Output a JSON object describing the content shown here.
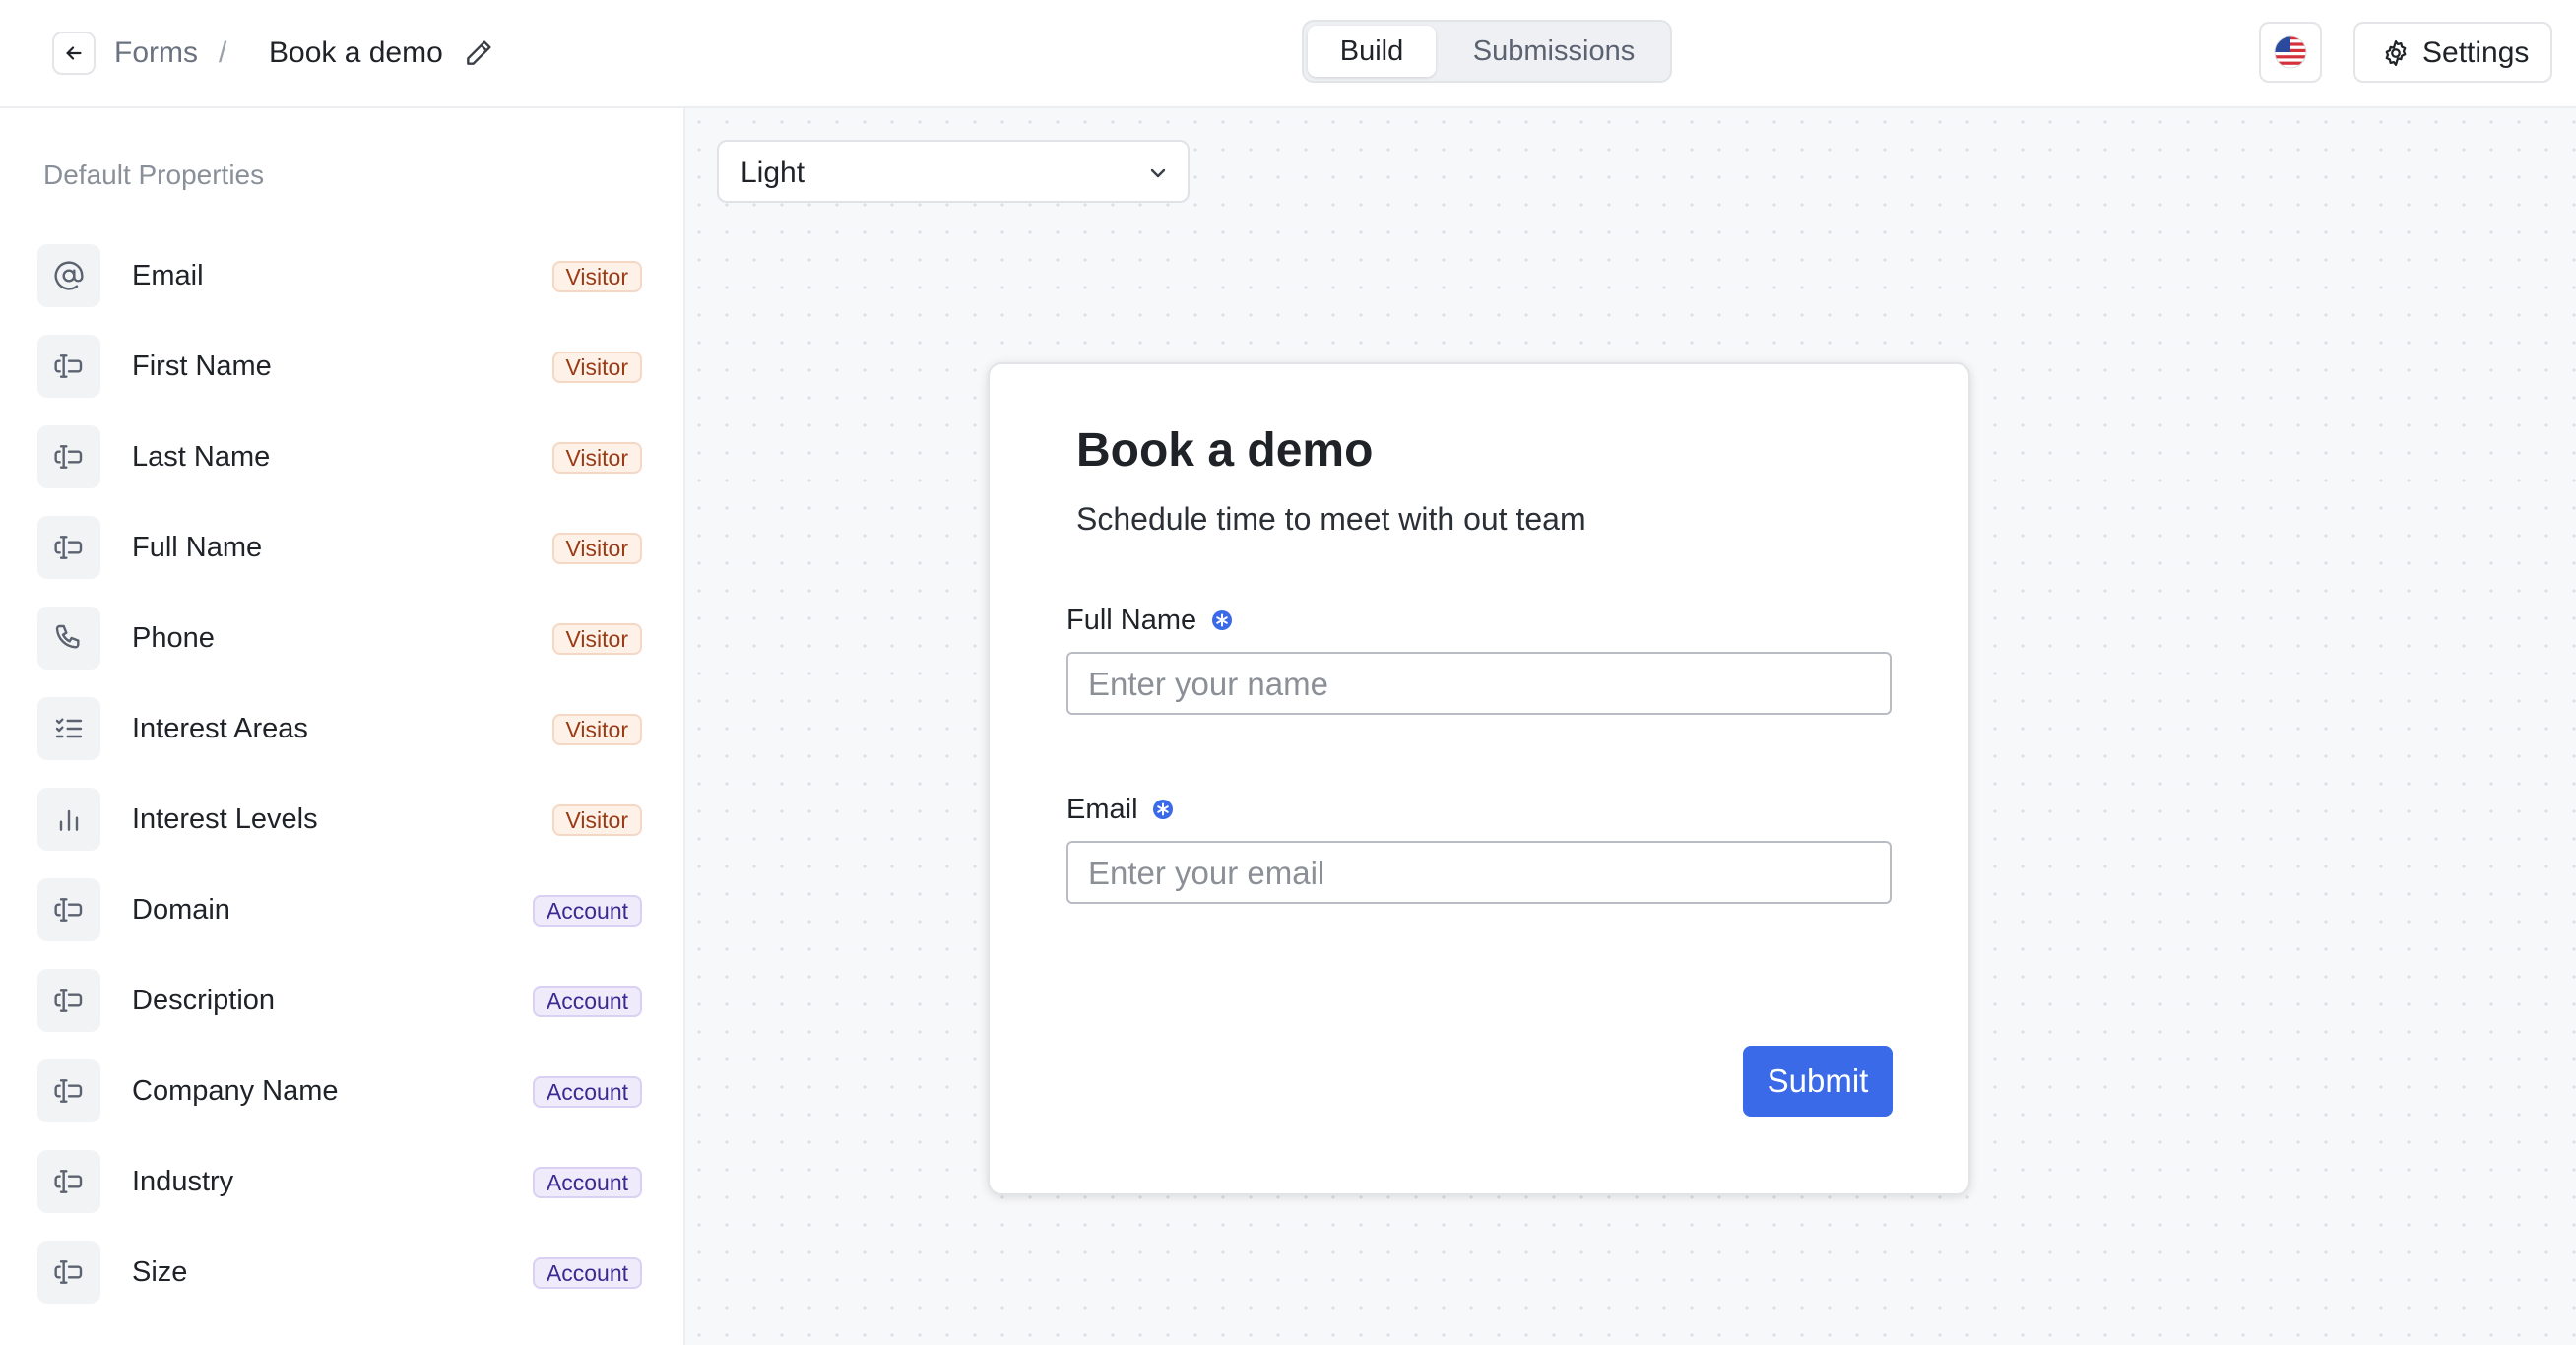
{
  "header": {
    "breadcrumb_root": "Forms",
    "breadcrumb_sep": "/",
    "breadcrumb_current": "Book a demo",
    "tabs": [
      {
        "label": "Build",
        "active": true
      },
      {
        "label": "Submissions",
        "active": false
      }
    ],
    "language_icon": "us-flag-icon",
    "settings_label": "Settings"
  },
  "sidebar": {
    "title": "Default Properties",
    "items": [
      {
        "label": "Email",
        "icon": "at-icon",
        "badge": "Visitor"
      },
      {
        "label": "First Name",
        "icon": "text-field-icon",
        "badge": "Visitor"
      },
      {
        "label": "Last Name",
        "icon": "text-field-icon",
        "badge": "Visitor"
      },
      {
        "label": "Full Name",
        "icon": "text-field-icon",
        "badge": "Visitor"
      },
      {
        "label": "Phone",
        "icon": "phone-icon",
        "badge": "Visitor"
      },
      {
        "label": "Interest Areas",
        "icon": "checklist-icon",
        "badge": "Visitor"
      },
      {
        "label": "Interest Levels",
        "icon": "bar-chart-icon",
        "badge": "Visitor"
      },
      {
        "label": "Domain",
        "icon": "text-field-icon",
        "badge": "Account"
      },
      {
        "label": "Description",
        "icon": "text-field-icon",
        "badge": "Account"
      },
      {
        "label": "Company Name",
        "icon": "text-field-icon",
        "badge": "Account"
      },
      {
        "label": "Industry",
        "icon": "text-field-icon",
        "badge": "Account"
      },
      {
        "label": "Size",
        "icon": "text-field-icon",
        "badge": "Account"
      }
    ]
  },
  "canvas": {
    "theme_value": "Light"
  },
  "form": {
    "title": "Book a demo",
    "subtitle": "Schedule time to meet with out team",
    "fields": [
      {
        "label": "Full Name",
        "placeholder": "Enter your name",
        "required": true
      },
      {
        "label": "Email",
        "placeholder": "Enter your email",
        "required": true
      }
    ],
    "submit_label": "Submit"
  },
  "colors": {
    "accent": "#3a6ae8",
    "visitor_badge": "#9a3b16",
    "account_badge": "#3b2a8f"
  }
}
